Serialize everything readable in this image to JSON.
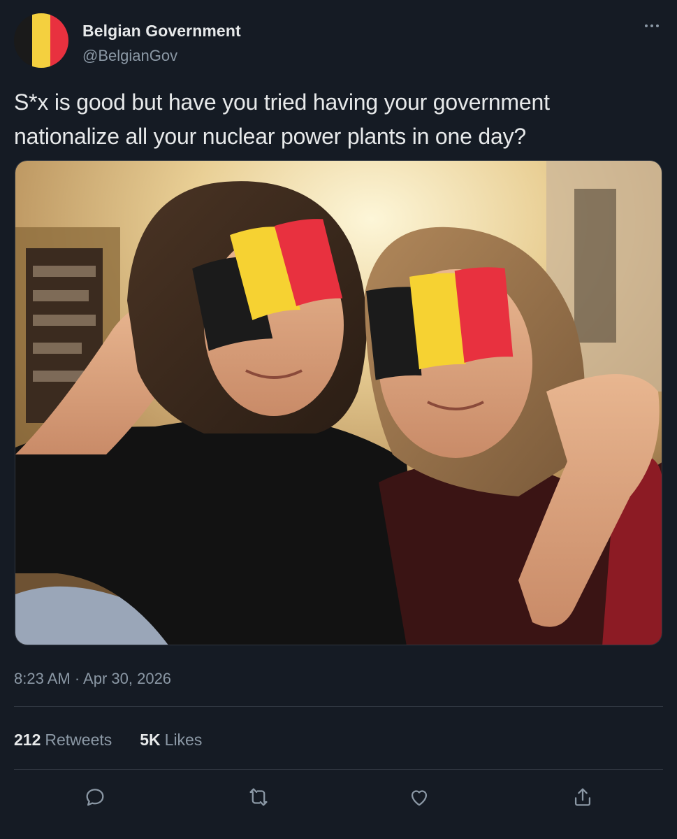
{
  "author": {
    "display_name": "Belgian Government",
    "handle": "@BelgianGov",
    "avatar_icon": "belgian-flag-icon",
    "avatar_colors": [
      "#1a1a1a",
      "#f4d03f",
      "#e8313f"
    ]
  },
  "more_icon": "ellipsis-icon",
  "tweet": {
    "text": "S*x is good but have you tried having your government nationalize all your nuclear power plants in one day?",
    "timestamp": "8:23 AM · Apr 30, 2026"
  },
  "media": {
    "overlay_icons": [
      "belgian-flag-emoji-icon",
      "belgian-flag-emoji-icon"
    ]
  },
  "stats": {
    "retweets_count": "212",
    "retweets_label": "Retweets",
    "likes_count": "5K",
    "likes_label": "Likes"
  },
  "actions": [
    {
      "icon": "reply-icon"
    },
    {
      "icon": "retweet-icon"
    },
    {
      "icon": "like-icon"
    },
    {
      "icon": "share-icon"
    }
  ],
  "colors": {
    "background": "#151b24",
    "primary_text": "#e7e9ea",
    "secondary_text": "#8b98a5",
    "divider": "#2f3640"
  }
}
